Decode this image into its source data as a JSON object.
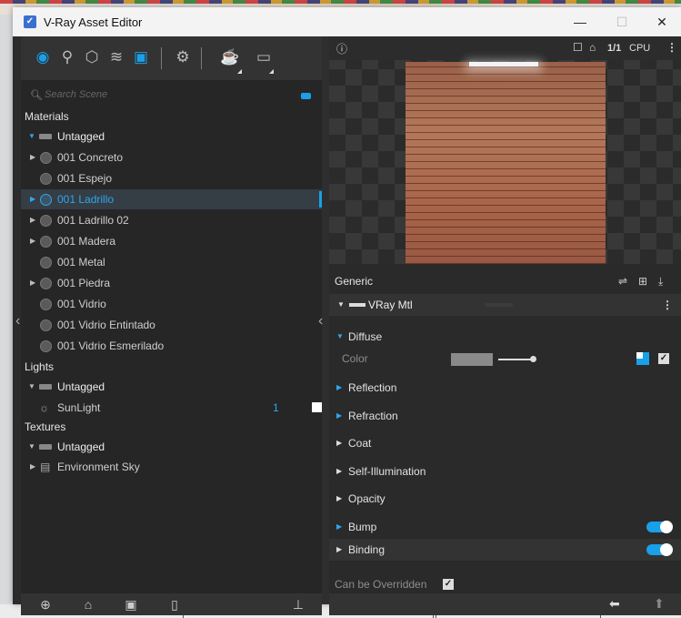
{
  "window": {
    "title": "V-Ray Asset Editor",
    "app_icon": "vray-logo-icon",
    "controls": {
      "minimize": "—",
      "maximize": "☐",
      "close": "✕"
    }
  },
  "toolbar": {
    "icons": [
      "materials-icon",
      "lights-icon",
      "geometry-icon",
      "render-elements-icon",
      "textures-icon",
      "settings-icon",
      "teapot-render-icon",
      "frame-buffer-icon"
    ],
    "active": "materials-icon"
  },
  "search": {
    "placeholder": "Search Scene"
  },
  "tree": {
    "materials_label": "Materials",
    "materials_group": "Untagged",
    "materials": [
      {
        "label": "001 Concreto",
        "expandable": true
      },
      {
        "label": "001 Espejo",
        "expandable": false
      },
      {
        "label": "001 Ladrillo",
        "expandable": true,
        "selected": true
      },
      {
        "label": "001 Ladrillo 02",
        "expandable": true
      },
      {
        "label": "001 Madera",
        "expandable": true
      },
      {
        "label": "001 Metal",
        "expandable": false
      },
      {
        "label": "001 Piedra",
        "expandable": true
      },
      {
        "label": "001 Vidrio",
        "expandable": false
      },
      {
        "label": "001 Vidrio Entintado",
        "expandable": false
      },
      {
        "label": "001 Vidrio Esmerilado",
        "expandable": false
      }
    ],
    "lights_label": "Lights",
    "lights_group": "Untagged",
    "lights": [
      {
        "label": "SunLight",
        "count": "1"
      }
    ],
    "textures_label": "Textures",
    "textures_group": "Untagged",
    "textures": [
      {
        "label": "Environment Sky"
      }
    ]
  },
  "preview": {
    "resolution": "1/1",
    "device": "CPU"
  },
  "properties": {
    "generic_label": "Generic",
    "material_type": "VRay Mtl",
    "diffuse_label": "Diffuse",
    "color_label": "Color",
    "diffuse_color": "#8a8a8a",
    "sections": [
      "Reflection",
      "Refraction",
      "Coat",
      "Self-Illumination",
      "Opacity"
    ],
    "bump_label": "Bump",
    "bump_enabled": true,
    "binding_label": "Binding",
    "binding_enabled": true,
    "override_label": "Can be Overridden",
    "override_checked": true
  },
  "colors": {
    "accent": "#19a0e8",
    "panel": "#262626"
  }
}
